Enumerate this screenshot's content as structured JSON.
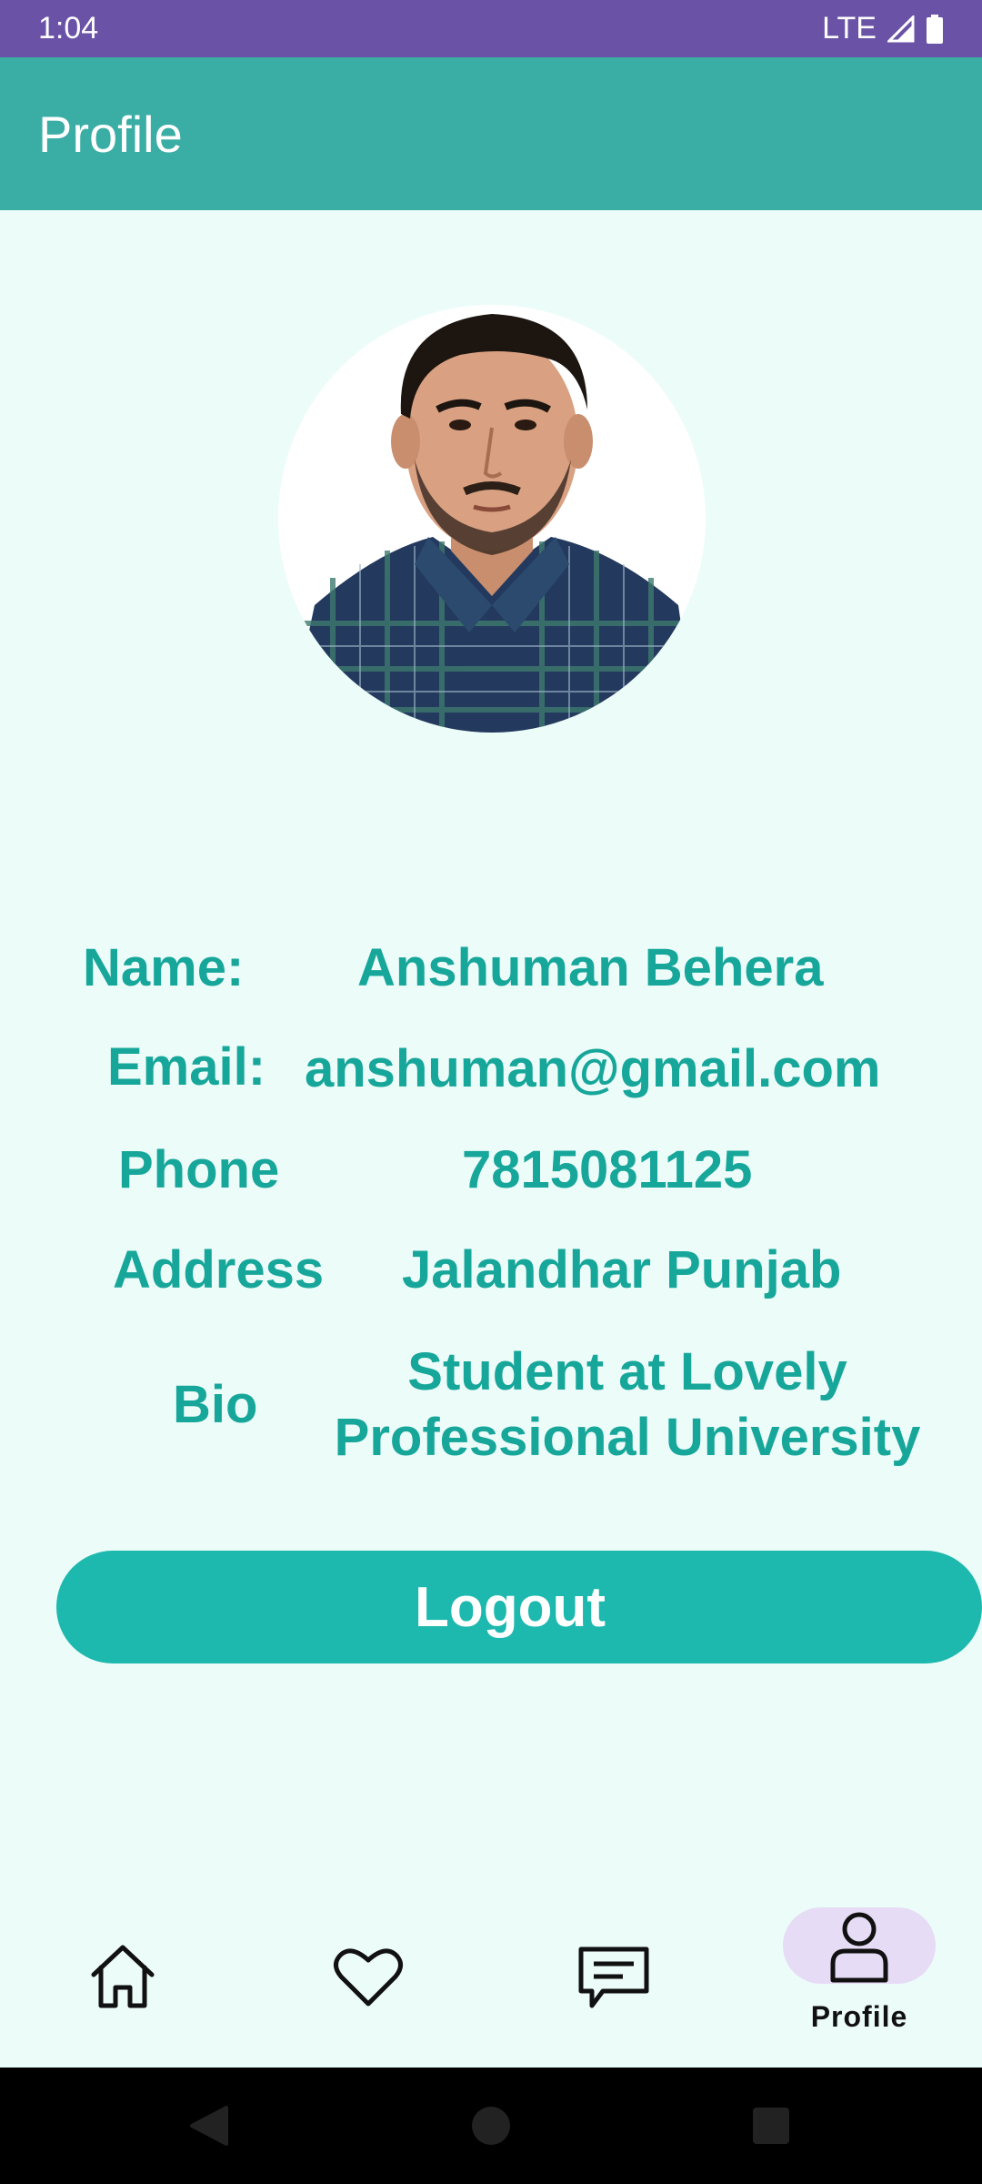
{
  "status_bar": {
    "time": "1:04",
    "network": "LTE"
  },
  "app_bar": {
    "title": "Profile"
  },
  "profile": {
    "name_label": "Name:",
    "name_value": "Anshuman Behera",
    "email_label": "Email:",
    "email_value": "anshuman@gmail.com",
    "phone_label": "Phone",
    "phone_value": "7815081125",
    "address_label": "Address",
    "address_value": "Jalandhar Punjab",
    "bio_label": "Bio",
    "bio_value": "Student at Lovely Professional University"
  },
  "logout": {
    "label": "Logout"
  },
  "bottom_nav": {
    "items": [
      {
        "icon": "home-icon",
        "label": ""
      },
      {
        "icon": "heart-icon",
        "label": ""
      },
      {
        "icon": "chat-icon",
        "label": ""
      },
      {
        "icon": "person-icon",
        "label": "Profile"
      }
    ]
  },
  "colors": {
    "status_bar": "#6A52A6",
    "app_bar": "#3AADA5",
    "accent_text": "#17A69A",
    "button": "#1DB8AE",
    "background": "#ECFCF9",
    "nav_pill": "#E7DCF6"
  }
}
